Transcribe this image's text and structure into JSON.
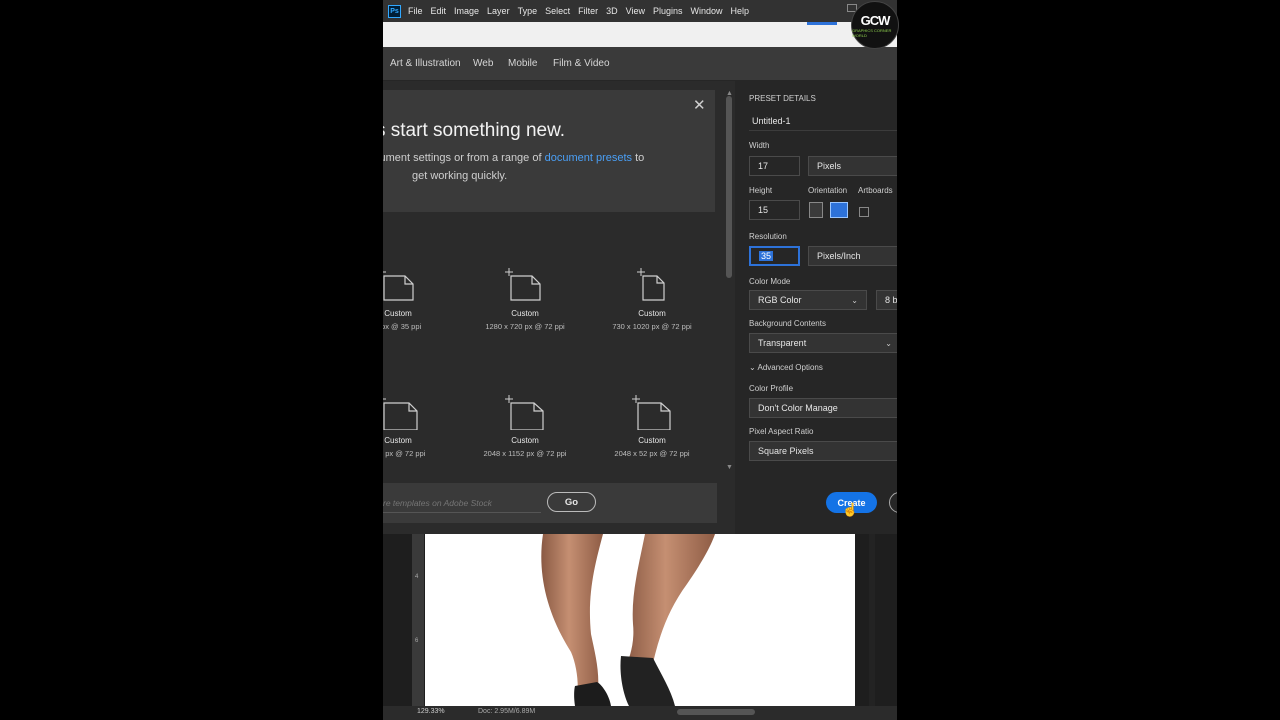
{
  "menu": {
    "logo": "Ps",
    "items": [
      "File",
      "Edit",
      "Image",
      "Layer",
      "Type",
      "Select",
      "Filter",
      "3D",
      "View",
      "Plugins",
      "Window",
      "Help"
    ]
  },
  "tabs": [
    "Art & Illustration",
    "Web",
    "Mobile",
    "Film & Video"
  ],
  "welcome": {
    "title": "s start something new.",
    "line1_prefix": "cument settings or from a range of ",
    "line1_link": "document presets",
    "line1_suffix": " to",
    "line2": "get working quickly.",
    "close": "✕"
  },
  "presets": [
    {
      "name": "Custom",
      "size": "5 px @ 35 ppi"
    },
    {
      "name": "Custom",
      "size": "1280 x 720 px @ 72 ppi"
    },
    {
      "name": "Custom",
      "size": "730 x 1020 px @ 72 ppi"
    },
    {
      "name": "Custom",
      "size": "423 px @ 72 ppi"
    },
    {
      "name": "Custom",
      "size": "2048 x 1152 px @ 72 ppi"
    },
    {
      "name": "Custom",
      "size": "2048 x 52 px @ 72 ppi"
    }
  ],
  "search": {
    "placeholder": "re templates on Adobe Stock",
    "go": "Go"
  },
  "details": {
    "header": "PRESET DETAILS",
    "name": "Untitled-1",
    "width_label": "Width",
    "width_value": "17",
    "width_unit": "Pixels",
    "height_label": "Height",
    "height_value": "15",
    "orientation_label": "Orientation",
    "artboards_label": "Artboards",
    "resolution_label": "Resolution",
    "resolution_value": "35",
    "resolution_unit": "Pixels/Inch",
    "color_mode_label": "Color Mode",
    "color_mode": "RGB Color",
    "bit_depth": "8 b",
    "background_label": "Background Contents",
    "background": "Transparent",
    "advanced": "Advanced Options",
    "color_profile_label": "Color Profile",
    "color_profile": "Don't Color Manage",
    "pixel_aspect_label": "Pixel Aspect Ratio",
    "pixel_aspect": "Square Pixels",
    "create": "Create"
  },
  "status": {
    "zoom": "129.33%",
    "doc": "Doc: 2.95M/6.89M"
  },
  "ruler": [
    "4",
    "6"
  ],
  "overlay": {
    "logo": "GCW",
    "sub": "GRAPHICS CORNER WORLD"
  },
  "colors": {
    "accent": "#1473e6",
    "link": "#4a9ff5",
    "panel": "#262626"
  }
}
